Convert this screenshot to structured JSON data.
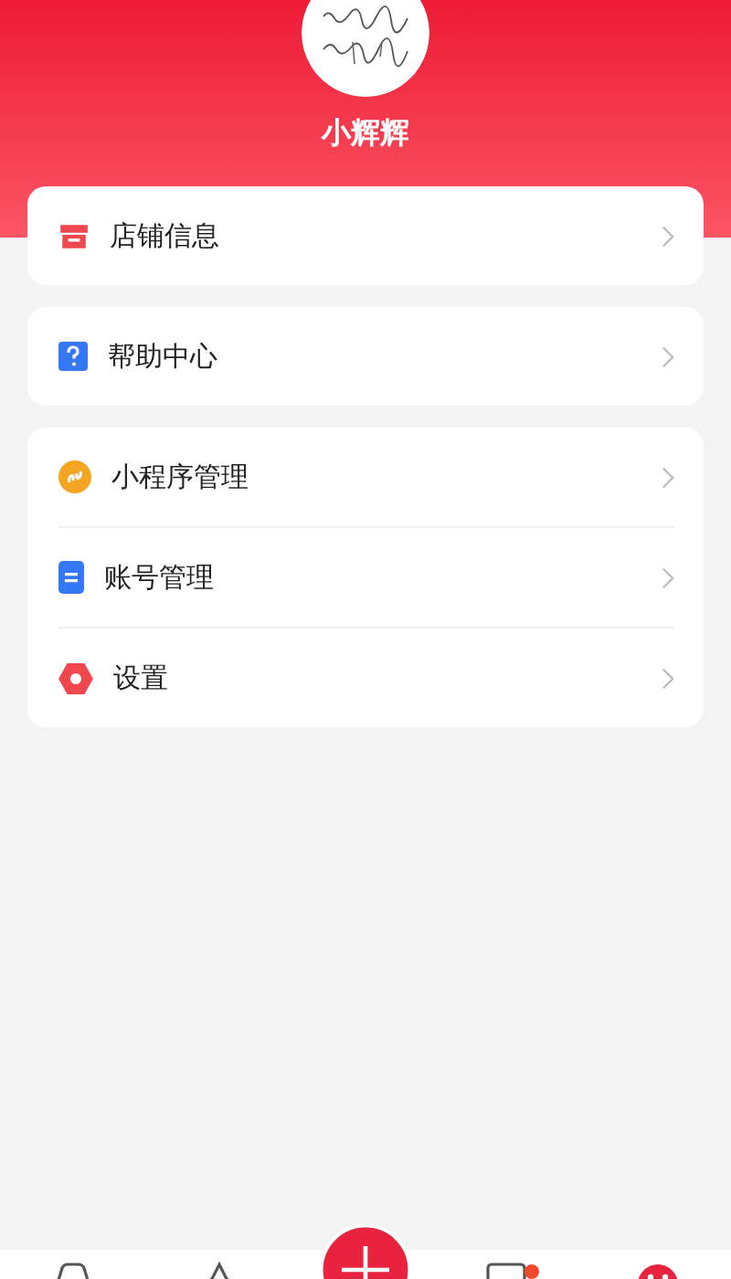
{
  "profile": {
    "name": "小辉辉"
  },
  "groups": [
    {
      "items": [
        {
          "label": "店铺信息",
          "kind": "store"
        }
      ]
    },
    {
      "items": [
        {
          "label": "帮助中心",
          "kind": "help"
        }
      ]
    },
    {
      "items": [
        {
          "label": "小程序管理",
          "kind": "miniapp"
        },
        {
          "label": "账号管理",
          "kind": "account"
        },
        {
          "label": "设置",
          "kind": "settings"
        }
      ]
    }
  ],
  "tab_bar": {
    "items": [
      {
        "kind": "car"
      },
      {
        "kind": "star"
      },
      {
        "kind": "add"
      },
      {
        "kind": "message",
        "badge": true
      },
      {
        "kind": "profile"
      }
    ]
  }
}
